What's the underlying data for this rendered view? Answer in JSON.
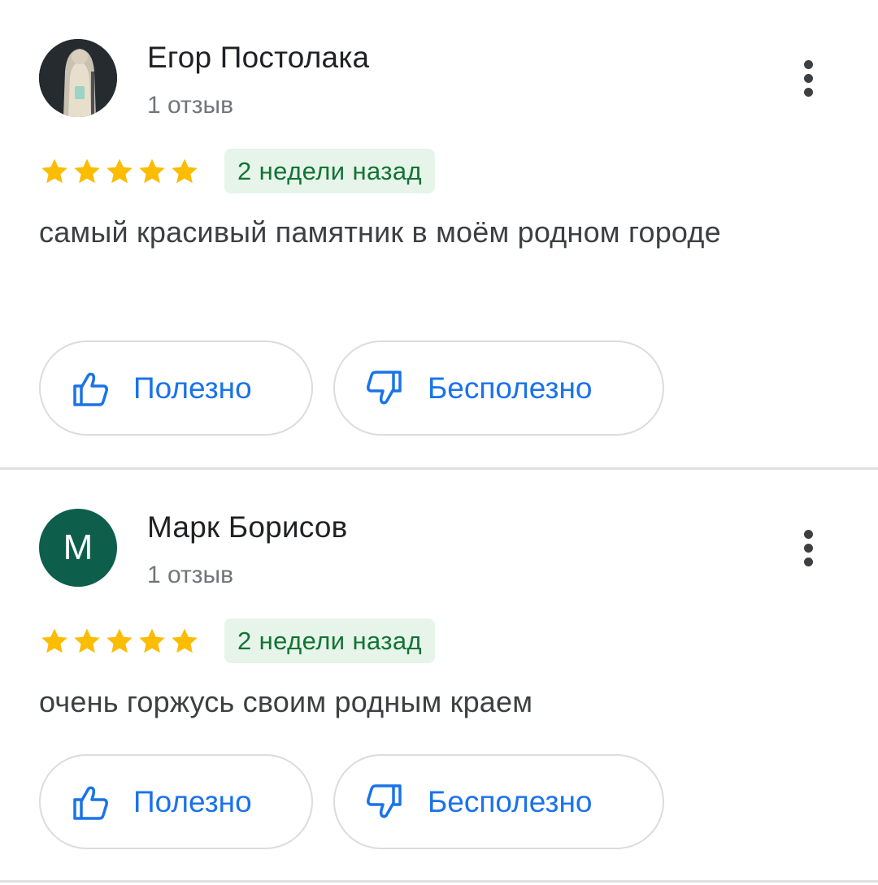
{
  "reviews": [
    {
      "author": "Егор Постолака",
      "count": "1 отзыв",
      "avatar": "photo",
      "avatar_color": "#23282d",
      "rating": 5,
      "date": "2 недели назад",
      "text": "самый красивый памятник в моём родном городе",
      "helpful_label": "Полезно",
      "unhelpful_label": "Бесполезно"
    },
    {
      "author": "Марк Борисов",
      "count": "1 отзыв",
      "avatar_letter": "М",
      "avatar_color": "#0d5e4a",
      "rating": 5,
      "date": "2 недели назад",
      "text": "очень горжусь своим родным краем",
      "helpful_label": "Полезно",
      "unhelpful_label": "Бесполезно"
    }
  ],
  "icons": {
    "more": "more-vert-icon",
    "star": "star-icon",
    "helpful": "thumb-up-icon",
    "unhelpful": "thumb-down-icon"
  },
  "colors": {
    "star": "#fbbc04",
    "link": "#1a73e8",
    "badge_bg": "#e6f4ea",
    "badge_text": "#137333"
  }
}
